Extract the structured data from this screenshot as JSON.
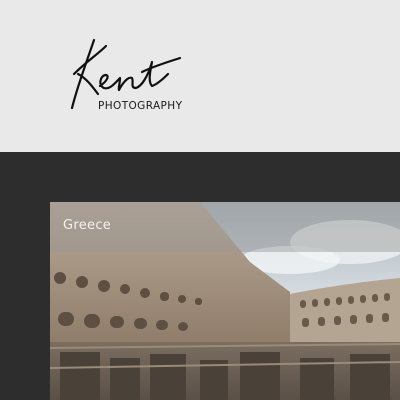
{
  "brand": {
    "logo_script": "Kent",
    "logo_sub": "PHOTOGRAPHY"
  },
  "gallery": {
    "card_title": "Greece",
    "image_subject": "colosseum-interior-photo"
  },
  "colors": {
    "header_bg": "#e9e9e9",
    "content_bg": "#2d2d2d",
    "logo_ink": "#111111",
    "title_text": "#f2f2f2"
  }
}
